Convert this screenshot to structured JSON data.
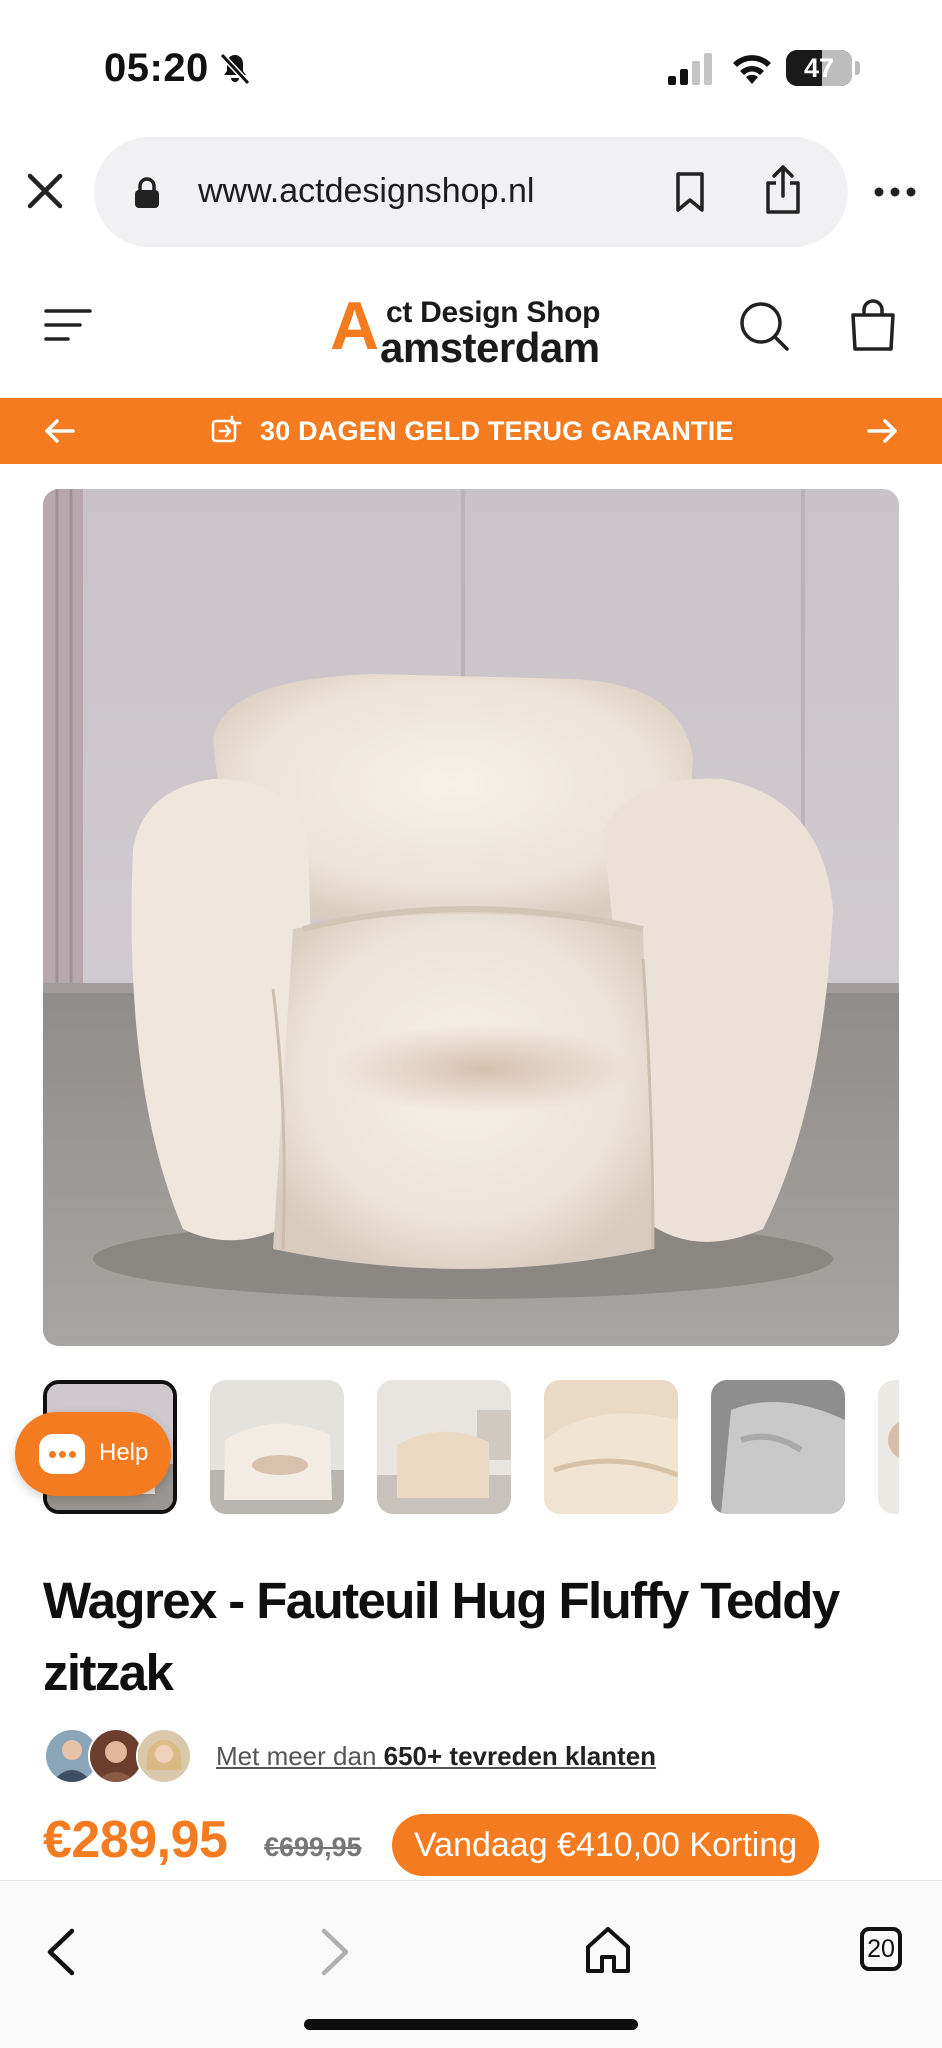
{
  "status_bar": {
    "time": "05:20",
    "battery": "47"
  },
  "browser": {
    "url": "www.actdesignshop.nl",
    "tab_count": "20"
  },
  "site": {
    "logo_initial": "A",
    "logo_line1": "ct Design Shop",
    "logo_line2": "amsterdam"
  },
  "promo": {
    "text": "30 DAGEN GELD TERUG GARANTIE"
  },
  "help": {
    "label": "Help"
  },
  "product": {
    "title": "Wagrex - Fauteuil Hug Fluffy Teddy zitzak",
    "social_prefix": "Met meer dan ",
    "social_bold": "650+ tevreden klanten",
    "price": "€289,95",
    "old_price": "€699,95",
    "discount": "Vandaag €410,00 Korting"
  },
  "colors": {
    "accent": "#f47b20",
    "text": "#111111"
  },
  "icons": [
    "bell-slash-icon",
    "signal-icon",
    "wifi-icon",
    "close-icon",
    "lock-icon",
    "bookmark-icon",
    "share-icon",
    "more-icon",
    "menu-icon",
    "search-icon",
    "bag-icon",
    "arrow-left-icon",
    "arrow-right-icon",
    "refund-icon",
    "chat-icon",
    "back-icon",
    "forward-icon",
    "home-icon"
  ]
}
